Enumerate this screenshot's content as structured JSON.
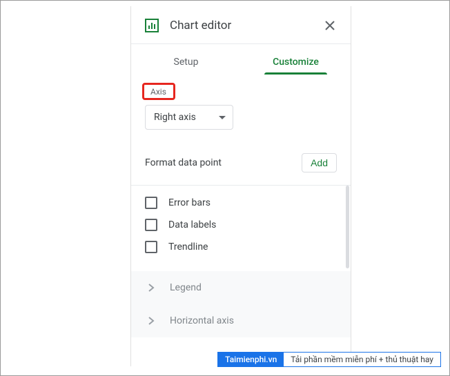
{
  "header": {
    "title": "Chart editor"
  },
  "tabs": {
    "setup": "Setup",
    "customize": "Customize"
  },
  "axis": {
    "label": "Axis",
    "value": "Right axis"
  },
  "format": {
    "label": "Format data point",
    "button": "Add"
  },
  "checks": {
    "error_bars": "Error bars",
    "data_labels": "Data labels",
    "trendline": "Trendline"
  },
  "accordions": {
    "legend": "Legend",
    "haxis": "Horizontal axis"
  },
  "watermark": {
    "site": "Taimienphi.vn",
    "tagline": "Tải phần mềm miễn phí + thủ thuật hay"
  }
}
